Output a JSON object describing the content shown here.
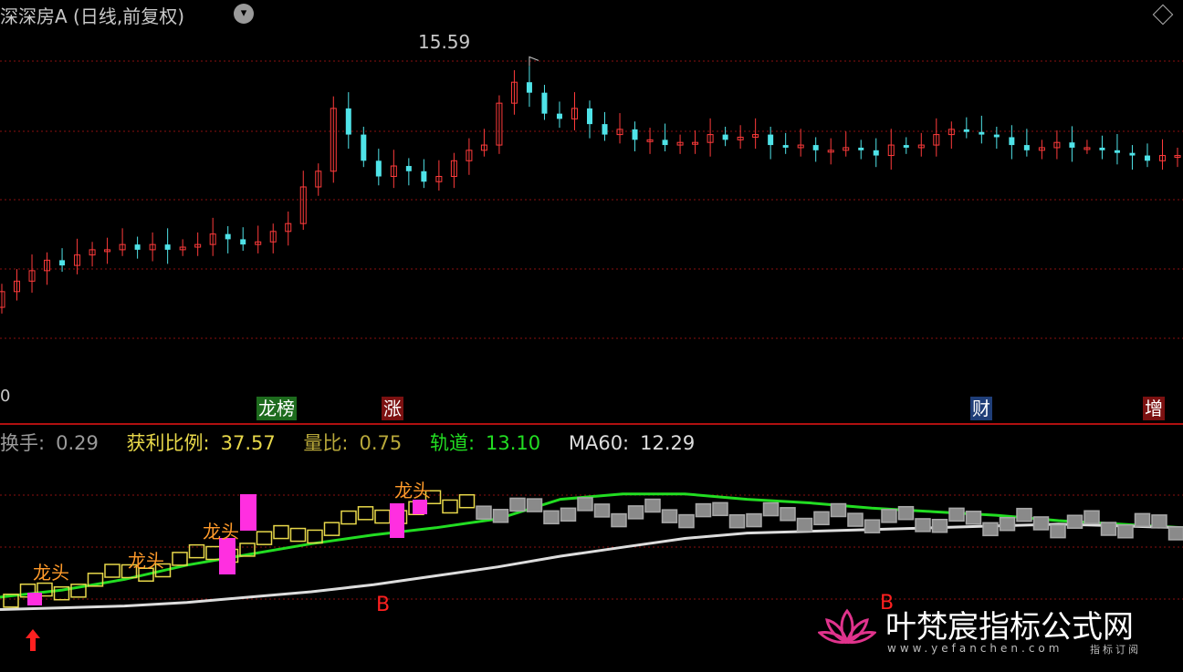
{
  "header": {
    "title": "深深房A (日线,前复权)",
    "caret": "▾"
  },
  "price_peak_label": "15.59",
  "price_scale_zero": "0",
  "event_tags": [
    {
      "text": "龙榜",
      "color": "#1d6b1d"
    },
    {
      "text": "涨",
      "color": "#7b1111"
    },
    {
      "text": "财",
      "color": "#1f3e78"
    },
    {
      "text": "增",
      "color": "#7b1111"
    }
  ],
  "indicator_line": [
    {
      "label": "换手:",
      "value": "0.29",
      "color": "#9a9a9a"
    },
    {
      "label": "获利比例:",
      "value": "37.57",
      "color": "#e8d84a"
    },
    {
      "label": "量比:",
      "value": "0.75",
      "color": "#b8a83a"
    },
    {
      "label": "轨道:",
      "value": "13.10",
      "color": "#22dd22"
    },
    {
      "label": "MA60:",
      "value": "12.29",
      "color": "#dddddd"
    }
  ],
  "watermark": {
    "title": "叶梵宸指标公式网",
    "url": "www.yefanchen.com",
    "sub": "指标订阅"
  },
  "chart_data": [
    {
      "type": "candlestick",
      "title": "深深房A (日线,前复权)",
      "peak": 15.59,
      "close_series": [
        11.1,
        11.3,
        11.5,
        11.7,
        11.6,
        11.8,
        11.9,
        11.9,
        12.0,
        11.9,
        12.0,
        11.9,
        11.95,
        12.0,
        12.2,
        12.1,
        12.0,
        12.05,
        12.25,
        12.4,
        13.1,
        13.4,
        14.6,
        14.1,
        13.6,
        13.3,
        13.5,
        13.4,
        13.2,
        13.3,
        13.6,
        13.8,
        13.9,
        14.7,
        15.1,
        14.9,
        14.5,
        14.4,
        14.6,
        14.3,
        14.1,
        14.2,
        14.0,
        14.0,
        13.9,
        13.95,
        13.95,
        14.1,
        14.0,
        14.05,
        14.1,
        13.9,
        13.85,
        13.9,
        13.8,
        13.8,
        13.85,
        13.8,
        13.7,
        13.9,
        13.85,
        13.9,
        14.1,
        14.2,
        14.15,
        14.1,
        14.05,
        13.9,
        13.8,
        13.85,
        13.95,
        13.85,
        13.85,
        13.8,
        13.75,
        13.7,
        13.6,
        13.7,
        13.7
      ]
    },
    {
      "type": "line",
      "series": [
        {
          "name": "轨道",
          "color": "#22dd22",
          "values": [
            10.4,
            10.6,
            10.9,
            11.3,
            11.6,
            11.9,
            12.15,
            12.35,
            12.6,
            13.15,
            13.3,
            13.3,
            13.15,
            13.05,
            12.9,
            12.8,
            12.7,
            12.55,
            12.45,
            12.35
          ]
        },
        {
          "name": "MA60",
          "color": "#dddddd",
          "values": [
            10.05,
            10.1,
            10.15,
            10.25,
            10.4,
            10.55,
            10.75,
            11.0,
            11.25,
            11.55,
            11.8,
            12.05,
            12.2,
            12.25,
            12.3,
            12.35,
            12.4,
            12.45,
            12.4,
            12.35
          ]
        }
      ],
      "annotations": [
        "龙头",
        "龙头",
        "龙头",
        "龙头",
        "B",
        "B"
      ]
    }
  ]
}
